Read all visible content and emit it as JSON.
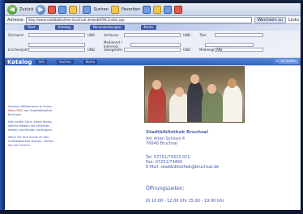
{
  "browser": {
    "toolbar": {
      "back_label": "Zurück",
      "search_label": "Suchen",
      "favorites_label": "Favoriten"
    },
    "address": {
      "label": "Adresse",
      "url": "http://www.stadtbibliothek-bruchsal.de/webOPAC/index.asp",
      "go_label": "Wechseln zu",
      "links_label": "Links"
    }
  },
  "site": {
    "header_tabs": [
      "Start",
      "Katalog",
      "Neuerwerbungen",
      "Konto"
    ]
  },
  "search_form": {
    "row1": {
      "label1": "Stichwort",
      "op1": "UND",
      "label2": "Verfasser",
      "op2": "UND",
      "label3": "Titel"
    },
    "row2": {
      "label1": "",
      "label2": "Medienart / Interesse",
      "label3": ""
    },
    "row3": {
      "label1": "Erscheinjahr",
      "op1": "UND",
      "label2": "Zweigstelle",
      "op2": "UND",
      "label3": "Mediengruppe",
      "select_value": "Alle"
    }
  },
  "catalog_bar": {
    "title": "Katalog",
    "tab_info": "Info",
    "tab_search": "Suchen",
    "tab_account": "Konto",
    "help": "Hilfe",
    "close": "Schließen"
  },
  "welcome": {
    "p1_start": "Herzlich Willkommen in Ihrem",
    "p1_highlight": "Web-OPAC",
    "p1_end": "der Stadtbibliothek Bruchsal.",
    "p2": "Hier sehen Sie in Ihrem Konto, welche Medien Sie entliehen haben und können verlängern.",
    "p3": "Wenn Sie Ihre Suche an den Stadtbibliothek starten, klicken Sie auf Suchen."
  },
  "library": {
    "name": "Stadtbibliothek Bruchsal",
    "street": "Am Alten Schloss 4",
    "city": "76646 Bruchsal",
    "tel": "Tel: 07251/79315 011",
    "fax": "Fax: 07251/79460",
    "email": "E-Mail: stadtbibliothek@bruchsal.de"
  },
  "hours": {
    "title": "Öffnungszeiten:",
    "row": "Di   10.00 - 12.00 Uhr   15.00 - 19.00 Uhr"
  }
}
